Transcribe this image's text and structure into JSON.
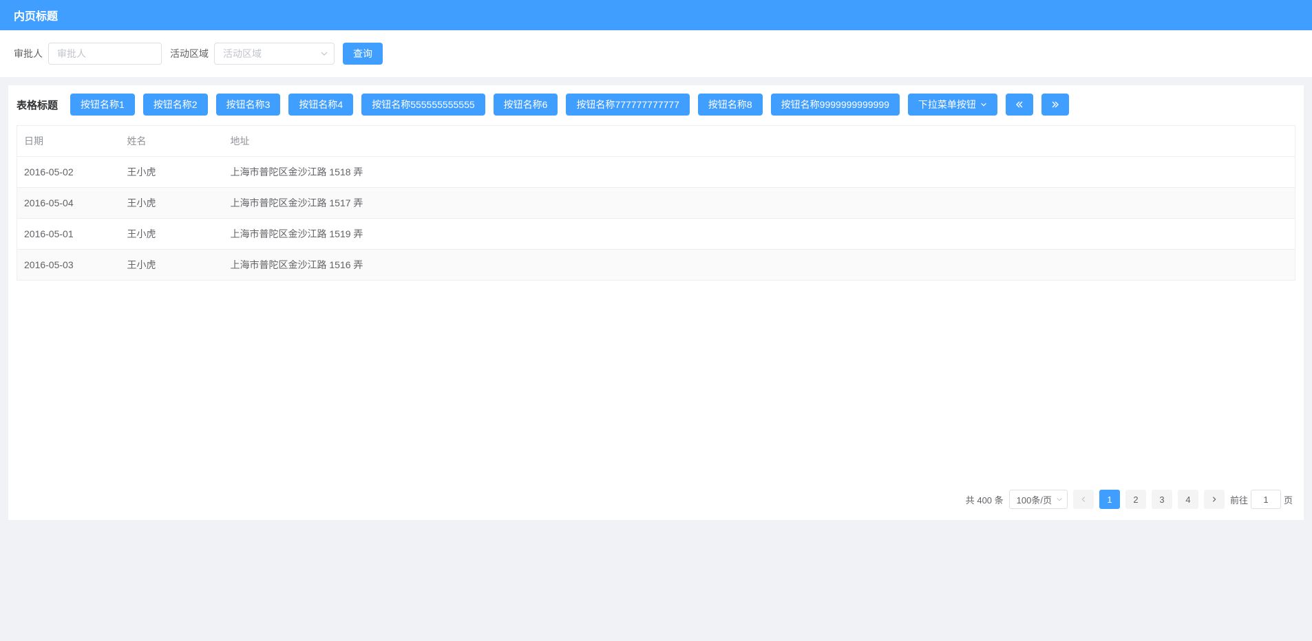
{
  "header": {
    "title": "内页标题"
  },
  "filter": {
    "approver_label": "审批人",
    "approver_placeholder": "审批人",
    "region_label": "活动区域",
    "region_placeholder": "活动区域",
    "query_label": "查询"
  },
  "card": {
    "title": "表格标题",
    "buttons": [
      "按钮名称1",
      "按钮名称2",
      "按钮名称3",
      "按钮名称4",
      "按钮名称555555555555",
      "按钮名称6",
      "按钮名称777777777777",
      "按钮名称8",
      "按钮名称9999999999999"
    ],
    "dropdown_label": "下拉菜单按钮"
  },
  "table": {
    "columns": [
      "日期",
      "姓名",
      "地址"
    ],
    "rows": [
      {
        "date": "2016-05-02",
        "name": "王小虎",
        "address": "上海市普陀区金沙江路 1518 弄"
      },
      {
        "date": "2016-05-04",
        "name": "王小虎",
        "address": "上海市普陀区金沙江路 1517 弄"
      },
      {
        "date": "2016-05-01",
        "name": "王小虎",
        "address": "上海市普陀区金沙江路 1519 弄"
      },
      {
        "date": "2016-05-03",
        "name": "王小虎",
        "address": "上海市普陀区金沙江路 1516 弄"
      }
    ]
  },
  "pagination": {
    "total_text": "共 400 条",
    "page_size": "100条/页",
    "pages": [
      "1",
      "2",
      "3",
      "4"
    ],
    "active_page": "1",
    "jump_prefix": "前往",
    "jump_value": "1",
    "jump_suffix": "页"
  }
}
